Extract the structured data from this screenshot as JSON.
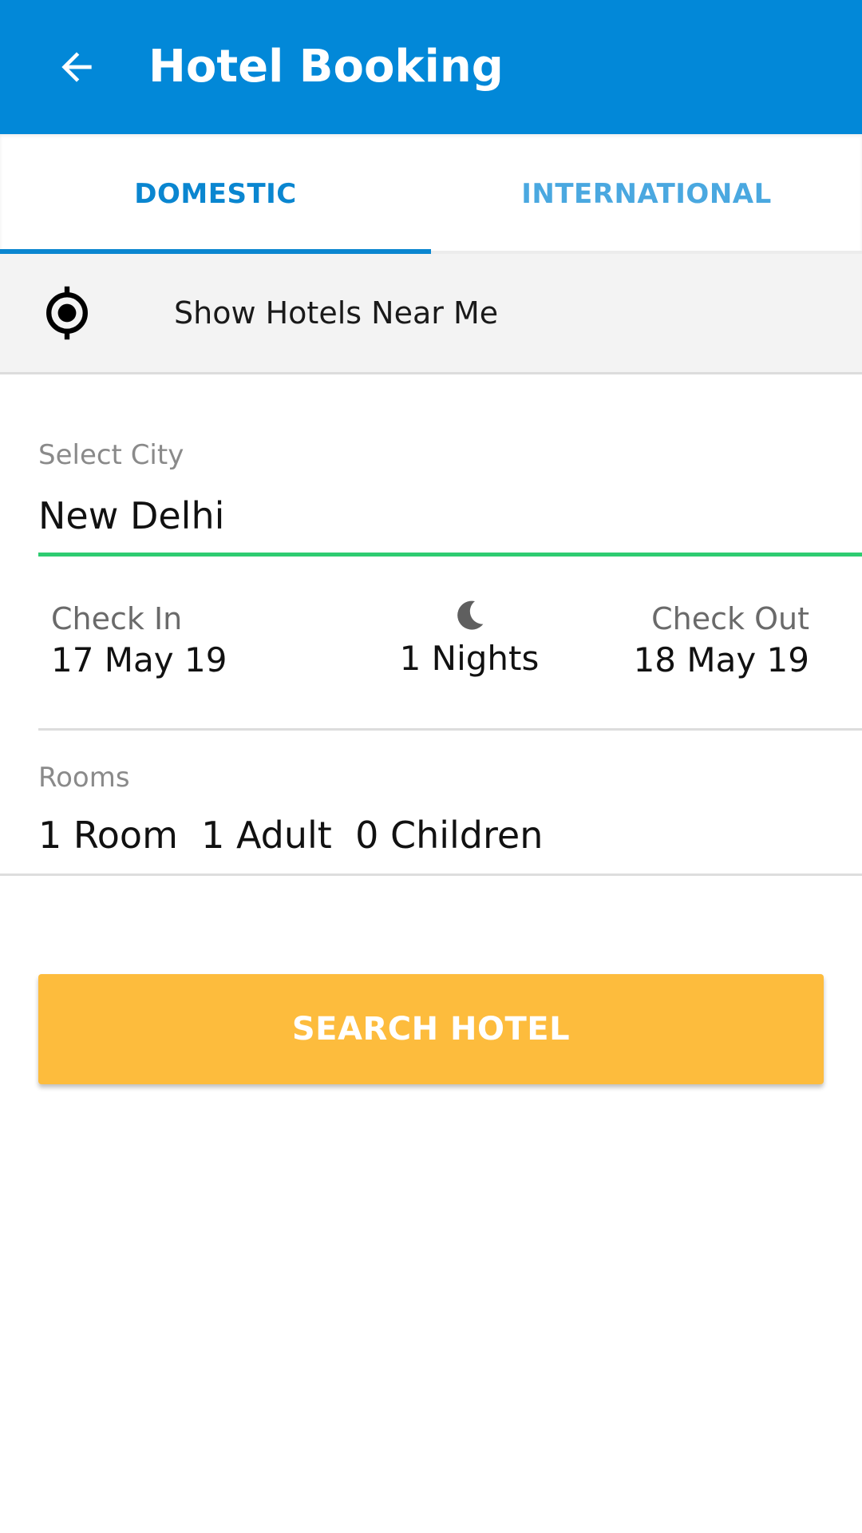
{
  "appbar": {
    "title": "Hotel Booking",
    "back_icon": "arrow-left-icon",
    "background": "#0288d8"
  },
  "tabs": [
    {
      "label": "DOMESTIC",
      "selected": true
    },
    {
      "label": "INTERNATIONAL",
      "selected": false
    }
  ],
  "near_me": {
    "label": "Show Hotels Near Me",
    "icon": "gps-target-icon"
  },
  "city": {
    "label": "Select City",
    "value": "New Delhi"
  },
  "dates": {
    "check_in_label": "Check In",
    "check_in_value": "17 May 19",
    "nights_icon": "moon-icon",
    "nights_value": "1 Nights",
    "check_out_label": "Check Out",
    "check_out_value": "18 May 19"
  },
  "rooms": {
    "label": "Rooms",
    "value": "1 Room  1 Adult  0 Children"
  },
  "search_button": {
    "label": "SEARCH HOTEL",
    "color": "#fdbc3d"
  },
  "colors": {
    "accent": "#0a86d0",
    "field_underline": "#2ecc71"
  }
}
